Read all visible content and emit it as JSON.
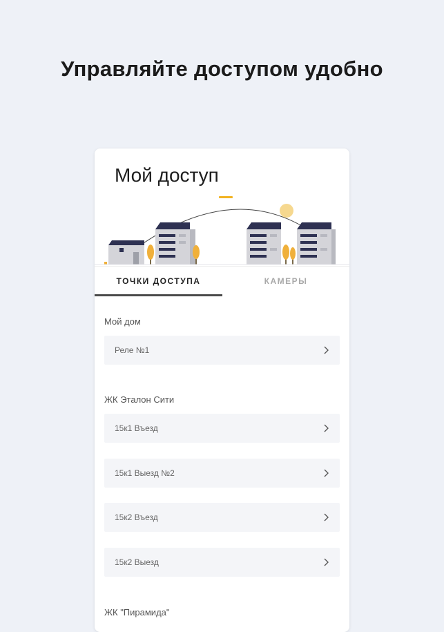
{
  "headline": "Управляйте доступом удобно",
  "card": {
    "title": "Мой доступ",
    "tabs": [
      {
        "label": "ТОЧКИ ДОСТУПА",
        "active": true
      },
      {
        "label": "КАМЕРЫ",
        "active": false
      }
    ],
    "groups": [
      {
        "label": "Мой дом",
        "items": [
          {
            "label": "Реле №1"
          }
        ]
      },
      {
        "label": "ЖК Эталон Сити",
        "items": [
          {
            "label": "15к1 Въезд"
          },
          {
            "label": "15к1 Выезд №2"
          },
          {
            "label": "15к2 Въезд"
          },
          {
            "label": "15к2 Выезд"
          }
        ]
      },
      {
        "label": "ЖК \"Пирамида\"",
        "items": []
      }
    ]
  },
  "colors": {
    "background": "#eef1f7",
    "building_roof": "#2e3152",
    "building_wall": "#cfcfd4",
    "tree": "#f0b03a",
    "sun": "#f6d88f",
    "arc_accent": "#f2b322"
  },
  "icons": {
    "row_chevron": "chevron-right-icon"
  }
}
